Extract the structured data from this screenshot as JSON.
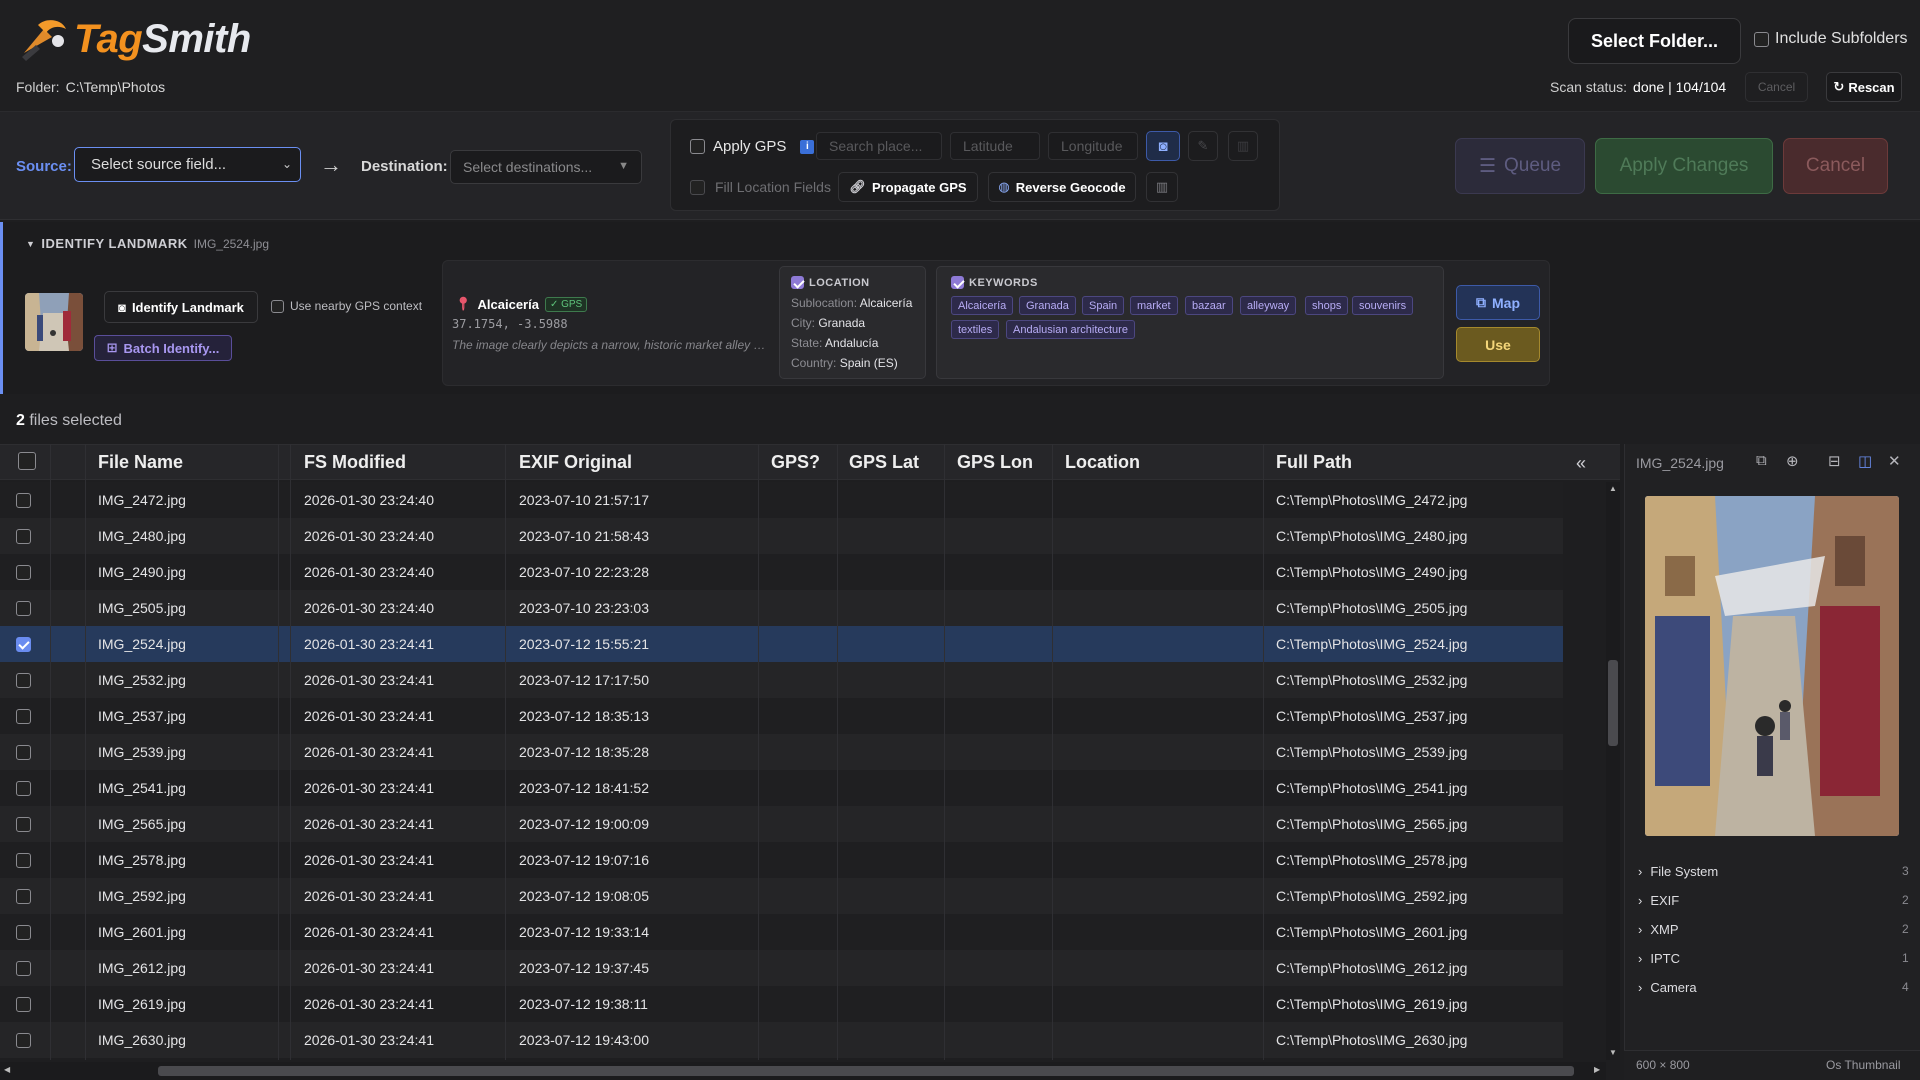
{
  "app": {
    "name_part1": "Tag",
    "name_part2": "Smith"
  },
  "header": {
    "folder_label": "Folder:",
    "folder_path": "C:\\Temp\\Photos",
    "select_folder": "Select Folder...",
    "include_subfolders": "Include Subfolders",
    "scan_status_label": "Scan status:",
    "scan_status_value": "done | 104/104",
    "cancel": "Cancel",
    "rescan": "Rescan"
  },
  "toolbar": {
    "source_label": "Source:",
    "source_placeholder": "Select source field...",
    "destination_label": "Destination:",
    "destination_placeholder": "Select destinations...",
    "apply_gps": "Apply GPS",
    "search_place_placeholder": "Search place...",
    "latitude_placeholder": "Latitude",
    "longitude_placeholder": "Longitude",
    "fill_location_fields": "Fill Location Fields",
    "propagate_gps": "Propagate GPS",
    "reverse_geocode": "Reverse Geocode",
    "queue": "Queue",
    "apply_changes": "Apply Changes",
    "cancel": "Cancel"
  },
  "landmark": {
    "title": "IDENTIFY LANDMARK",
    "file": "IMG_2524.jpg",
    "identify_button": "Identify Landmark",
    "use_nearby": "Use nearby GPS context",
    "batch_button": "Batch Identify...",
    "place_name": "Alcaicería",
    "gps_badge": "✓ GPS",
    "coords": "37.1754, -3.5988",
    "description": "The image clearly depicts a narrow, historic market alley with stalls",
    "location_title": "LOCATION",
    "sublocation_label": "Sublocation:",
    "sublocation": "Alcaicería",
    "city_label": "City:",
    "city": "Granada",
    "state_label": "State:",
    "state": "Andalucía",
    "country_label": "Country:",
    "country": "Spain (ES)",
    "keywords_title": "KEYWORDS",
    "keywords": [
      "Alcaicería",
      "Granada",
      "Spain",
      "market",
      "bazaar",
      "alleyway",
      "shops",
      "souvenirs",
      "textiles",
      "Andalusian architecture"
    ],
    "map_button": "Map",
    "use_button": "Use"
  },
  "selection": {
    "count": "2",
    "text": "files selected"
  },
  "table": {
    "columns": [
      "File Name",
      "FS Modified",
      "EXIF Original",
      "GPS?",
      "GPS Lat",
      "GPS Lon",
      "Location",
      "Full Path"
    ],
    "rows": [
      {
        "name": "IMG_2472.jpg",
        "fs": "2026-01-30 23:24:40",
        "exif": "2023-07-10 21:57:17",
        "path": "C:\\Temp\\Photos\\IMG_2472.jpg",
        "selected": false
      },
      {
        "name": "IMG_2480.jpg",
        "fs": "2026-01-30 23:24:40",
        "exif": "2023-07-10 21:58:43",
        "path": "C:\\Temp\\Photos\\IMG_2480.jpg",
        "selected": false
      },
      {
        "name": "IMG_2490.jpg",
        "fs": "2026-01-30 23:24:40",
        "exif": "2023-07-10 22:23:28",
        "path": "C:\\Temp\\Photos\\IMG_2490.jpg",
        "selected": false
      },
      {
        "name": "IMG_2505.jpg",
        "fs": "2026-01-30 23:24:40",
        "exif": "2023-07-10 23:23:03",
        "path": "C:\\Temp\\Photos\\IMG_2505.jpg",
        "selected": false
      },
      {
        "name": "IMG_2524.jpg",
        "fs": "2026-01-30 23:24:41",
        "exif": "2023-07-12 15:55:21",
        "path": "C:\\Temp\\Photos\\IMG_2524.jpg",
        "selected": true
      },
      {
        "name": "IMG_2532.jpg",
        "fs": "2026-01-30 23:24:41",
        "exif": "2023-07-12 17:17:50",
        "path": "C:\\Temp\\Photos\\IMG_2532.jpg",
        "selected": false
      },
      {
        "name": "IMG_2537.jpg",
        "fs": "2026-01-30 23:24:41",
        "exif": "2023-07-12 18:35:13",
        "path": "C:\\Temp\\Photos\\IMG_2537.jpg",
        "selected": false
      },
      {
        "name": "IMG_2539.jpg",
        "fs": "2026-01-30 23:24:41",
        "exif": "2023-07-12 18:35:28",
        "path": "C:\\Temp\\Photos\\IMG_2539.jpg",
        "selected": false
      },
      {
        "name": "IMG_2541.jpg",
        "fs": "2026-01-30 23:24:41",
        "exif": "2023-07-12 18:41:52",
        "path": "C:\\Temp\\Photos\\IMG_2541.jpg",
        "selected": false
      },
      {
        "name": "IMG_2565.jpg",
        "fs": "2026-01-30 23:24:41",
        "exif": "2023-07-12 19:00:09",
        "path": "C:\\Temp\\Photos\\IMG_2565.jpg",
        "selected": false
      },
      {
        "name": "IMG_2578.jpg",
        "fs": "2026-01-30 23:24:41",
        "exif": "2023-07-12 19:07:16",
        "path": "C:\\Temp\\Photos\\IMG_2578.jpg",
        "selected": false
      },
      {
        "name": "IMG_2592.jpg",
        "fs": "2026-01-30 23:24:41",
        "exif": "2023-07-12 19:08:05",
        "path": "C:\\Temp\\Photos\\IMG_2592.jpg",
        "selected": false
      },
      {
        "name": "IMG_2601.jpg",
        "fs": "2026-01-30 23:24:41",
        "exif": "2023-07-12 19:33:14",
        "path": "C:\\Temp\\Photos\\IMG_2601.jpg",
        "selected": false
      },
      {
        "name": "IMG_2612.jpg",
        "fs": "2026-01-30 23:24:41",
        "exif": "2023-07-12 19:37:45",
        "path": "C:\\Temp\\Photos\\IMG_2612.jpg",
        "selected": false
      },
      {
        "name": "IMG_2619.jpg",
        "fs": "2026-01-30 23:24:41",
        "exif": "2023-07-12 19:38:11",
        "path": "C:\\Temp\\Photos\\IMG_2619.jpg",
        "selected": false
      },
      {
        "name": "IMG_2630.jpg",
        "fs": "2026-01-30 23:24:41",
        "exif": "2023-07-12 19:43:00",
        "path": "C:\\Temp\\Photos\\IMG_2630.jpg",
        "selected": false
      }
    ]
  },
  "preview_panel": {
    "file": "IMG_2524.jpg",
    "sections": [
      {
        "name": "File System",
        "count": "3"
      },
      {
        "name": "EXIF",
        "count": "2"
      },
      {
        "name": "XMP",
        "count": "2"
      },
      {
        "name": "IPTC",
        "count": "1"
      },
      {
        "name": "Camera",
        "count": "4"
      }
    ],
    "dimensions": "600 × 800",
    "thumb_label": "Os Thumbnail"
  },
  "colors": {
    "accent": "#6b8ff2",
    "brand_orange": "#f3911f",
    "selected_row": "#263a5c",
    "keyword": "#b7acf5"
  }
}
